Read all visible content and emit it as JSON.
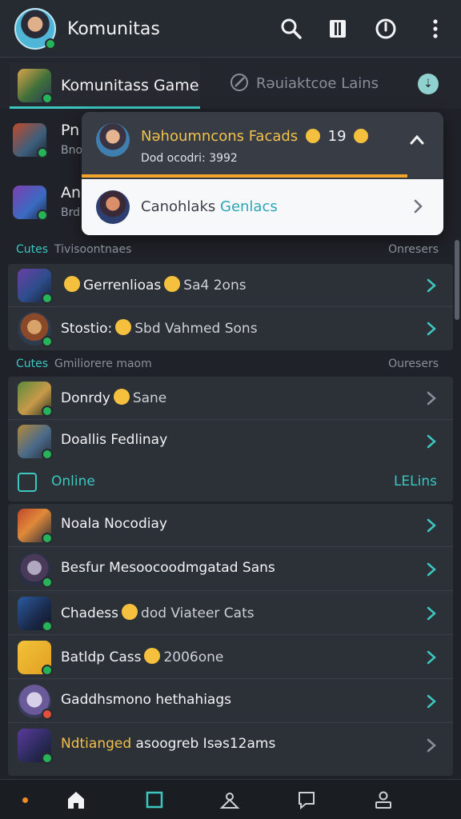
{
  "header": {
    "title": "Komunitas",
    "icons": [
      "search-icon",
      "bookmark-icon",
      "power-icon",
      "more-vertical-icon"
    ]
  },
  "tabs": {
    "active_label": "Komunitass Game",
    "second_label": "Rəuiaktcoe Lains",
    "second_icon": "pen-icon"
  },
  "partial_rows": [
    {
      "label": "Pn",
      "sub": "Bno"
    },
    {
      "label": "An",
      "sub": "Brd"
    }
  ],
  "dropdown": {
    "title": "Nəhoumncons Facads",
    "title_count": "19",
    "subtitle": "Dod ocodri: 3992",
    "option_prefix": "Canohlaks",
    "option_accent": "Genlacs",
    "progress": 0.9
  },
  "sections": [
    {
      "tag": "Cutes",
      "label": "Tivisoontnaes",
      "right": "Onresers"
    },
    {
      "tag": "Cutes",
      "label": "Gmiliorere maom",
      "right": "Ouresers"
    }
  ],
  "list_a": [
    {
      "prefix": "",
      "middle": "Gerrenlioas",
      "suffix": "Sa4  2ons"
    },
    {
      "prefix": "Stostio:",
      "middle": "",
      "suffix": "Sbd Vahmed Sons"
    }
  ],
  "list_b": [
    {
      "label": "Donrdy",
      "suffix": "Sane"
    },
    {
      "label": "Doallis Fedlinay",
      "suffix": ""
    }
  ],
  "online": {
    "label": "Online",
    "right": "LELins"
  },
  "list_c": [
    {
      "label": "Noala Nocodiay",
      "suffix": "",
      "style": ""
    },
    {
      "label": "Besfur Mesoocoodmgatad Sans",
      "suffix": "",
      "style": ""
    },
    {
      "label": "Chadess",
      "suffix": "dod Viateer Cats",
      "style": "emoji"
    },
    {
      "label": "Batldp Cass",
      "suffix": "2006one",
      "style": "emoji"
    },
    {
      "label": "Gaddhsmono hethahiags",
      "suffix": "",
      "style": ""
    },
    {
      "label": "Ndtianged",
      "suffix": "asoogreb Isəs12ams",
      "style": "gold"
    }
  ],
  "bottom_nav": [
    "home-icon",
    "square-icon",
    "community-icon",
    "chat-icon",
    "profile-icon"
  ],
  "colors": {
    "accent": "#3cc7c0",
    "gold": "#f3c14b",
    "progress": "#f3a528",
    "online_dot": "#27b35a"
  }
}
